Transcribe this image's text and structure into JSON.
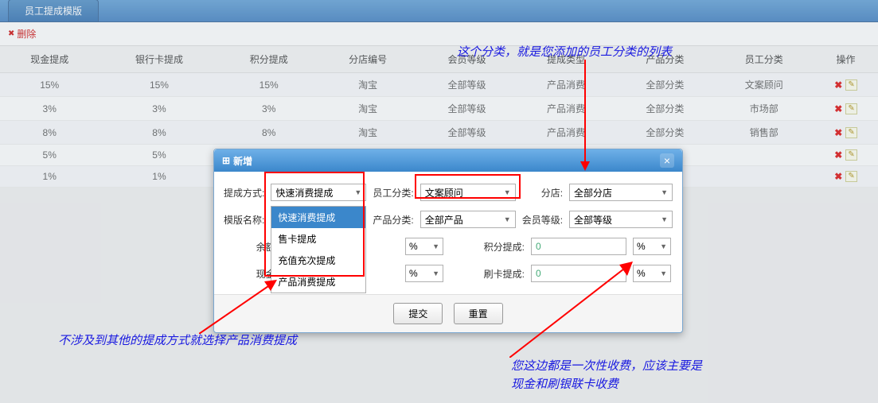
{
  "pageTab": "员工提成模版",
  "toolbar": {
    "delete": "删除"
  },
  "table": {
    "headers": [
      "现金提成",
      "银行卡提成",
      "积分提成",
      "分店编号",
      "会员等级",
      "提成类型",
      "产品分类",
      "员工分类",
      "操作"
    ],
    "rows": [
      {
        "cash": "15%",
        "bank": "15%",
        "points": "15%",
        "store": "淘宝",
        "level": "全部等级",
        "ctype": "产品消费",
        "pcat": "全部分类",
        "ecat": "文案顾问"
      },
      {
        "cash": "3%",
        "bank": "3%",
        "points": "3%",
        "store": "淘宝",
        "level": "全部等级",
        "ctype": "产品消费",
        "pcat": "全部分类",
        "ecat": "市场部"
      },
      {
        "cash": "8%",
        "bank": "8%",
        "points": "8%",
        "store": "淘宝",
        "level": "全部等级",
        "ctype": "产品消费",
        "pcat": "全部分类",
        "ecat": "销售部"
      },
      {
        "cash": "5%",
        "bank": "5%",
        "points": "",
        "store": "",
        "level": "",
        "ctype": "",
        "pcat": "",
        "ecat": ""
      },
      {
        "cash": "1%",
        "bank": "1%",
        "points": "",
        "store": "",
        "level": "",
        "ctype": "",
        "pcat": "",
        "ecat": ""
      }
    ]
  },
  "modal": {
    "title": "新增",
    "labels": {
      "method": "提成方式:",
      "ecat": "员工分类:",
      "store": "分店:",
      "tplname": "模版名称:",
      "pcat": "产品分类:",
      "level": "会员等级:",
      "balance": "余额提成:",
      "points": "积分提成:",
      "cash": "现金提成:",
      "card": "刷卡提成:"
    },
    "values": {
      "method": "快速消费提成",
      "ecat": "文案顾问",
      "store": "全部分店",
      "tplname": "",
      "pcat": "全部产品",
      "level": "全部等级",
      "balance": "",
      "points": "0",
      "cash": "",
      "card": "0",
      "unit": "%"
    },
    "methodOptions": [
      "快速消费提成",
      "售卡提成",
      "充值充次提成",
      "产品消费提成"
    ],
    "buttons": {
      "submit": "提交",
      "reset": "重置"
    }
  },
  "annotations": {
    "top": "这个分类，就是您添加的员工分类的列表",
    "left": "不涉及到其他的提成方式就选择产品消费提成",
    "right1": "您这边都是一次性收费，应该主要是",
    "right2": "现金和刷银联卡收费"
  }
}
